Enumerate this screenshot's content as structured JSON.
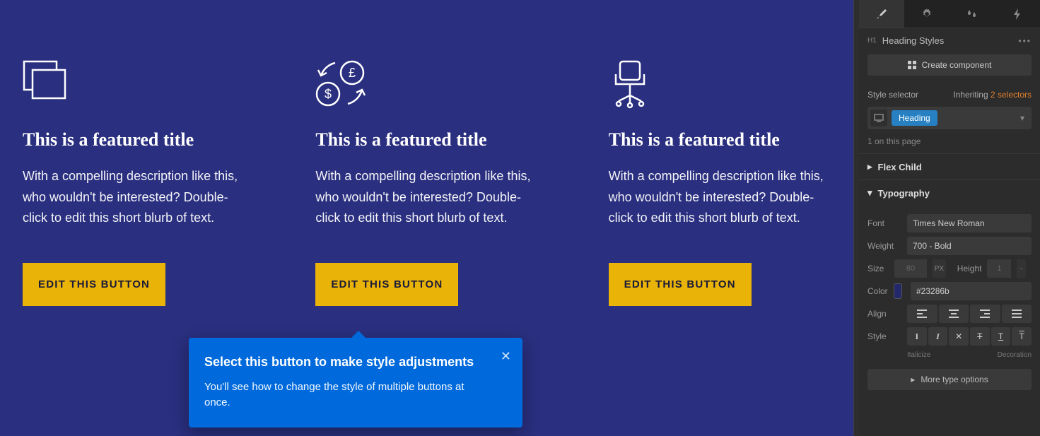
{
  "cards": [
    {
      "title": "This is a featured title",
      "desc": "With a compelling description like this, who wouldn't be interested? Double-click to edit this short blurb of text.",
      "button": "EDIT THIS BUTTON"
    },
    {
      "title": "This is a featured title",
      "desc": "With a compelling description like this, who wouldn't be interested? Double-click to edit this short blurb of text.",
      "button": "EDIT THIS BUTTON"
    },
    {
      "title": "This is a featured title",
      "desc": "With a compelling description like this, who wouldn't be interested? Double-click to edit this short blurb of text.",
      "button": "EDIT THIS BUTTON"
    }
  ],
  "tooltip": {
    "title": "Select this button to make style adjustments",
    "body": "You'll see how to change the style of multiple buttons at once."
  },
  "panel": {
    "heading_styles_label": "Heading Styles",
    "h1_tag": "H1",
    "create_component": "Create component",
    "style_selector_label": "Style selector",
    "inheriting_prefix": "Inheriting ",
    "inheriting_count": "2 selectors",
    "chip": "Heading",
    "on_page": "1 on this page",
    "sections": {
      "flex_child": "Flex Child",
      "typography": "Typography"
    },
    "typography": {
      "font_label": "Font",
      "font_value": "Times New Roman",
      "weight_label": "Weight",
      "weight_value": "700 - Bold",
      "size_label": "Size",
      "size_value": "80",
      "size_unit": "PX",
      "height_label": "Height",
      "height_value": "1",
      "height_unit": "-",
      "color_label": "Color",
      "color_value": "#23286b",
      "align_label": "Align",
      "style_label": "Style",
      "italicize": "Italicize",
      "decoration": "Decoration",
      "more_options": "More type options"
    }
  }
}
